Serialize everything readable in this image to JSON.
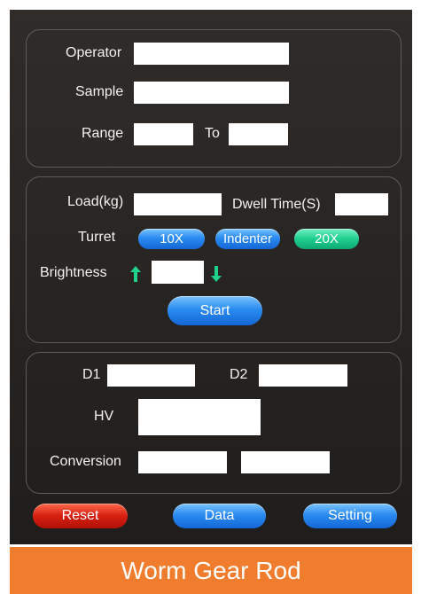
{
  "sample_info": {
    "operator_label": "Operator",
    "operator_value": "",
    "sample_label": "Sample",
    "sample_value": "",
    "range_label": "Range",
    "range_from_value": "",
    "range_to_label": "To",
    "range_to_value": ""
  },
  "test_params": {
    "load_label": "Load(kg)",
    "load_value": "",
    "dwell_label": "Dwell Time(S)",
    "dwell_value": "",
    "turret_label": "Turret",
    "turret_buttons": [
      {
        "label": "10X",
        "color": "blue"
      },
      {
        "label": "Indenter",
        "color": "blue"
      },
      {
        "label": "20X",
        "color": "green"
      }
    ],
    "brightness_label": "Brightness",
    "brightness_up_icon": "arrow-up-icon",
    "brightness_down_icon": "arrow-down-icon",
    "brightness_value": "",
    "start_label": "Start"
  },
  "results": {
    "d1_label": "D1",
    "d1_value": "",
    "d2_label": "D2",
    "d2_value": "",
    "hv_label": "HV",
    "hv_value": "",
    "conversion_label": "Conversion",
    "conversion_value_1": "",
    "conversion_value_2": ""
  },
  "footer_buttons": {
    "reset_label": "Reset",
    "data_label": "Data",
    "setting_label": "Setting"
  },
  "banner": {
    "title": "Worm Gear Rod"
  },
  "colors": {
    "accent_blue": "#2a8bf0",
    "accent_green": "#1fcf8f",
    "reset_red": "#d61e10",
    "arrow_green": "#1fd18a",
    "banner_orange": "#f07d2e",
    "background": "#2a2725"
  }
}
